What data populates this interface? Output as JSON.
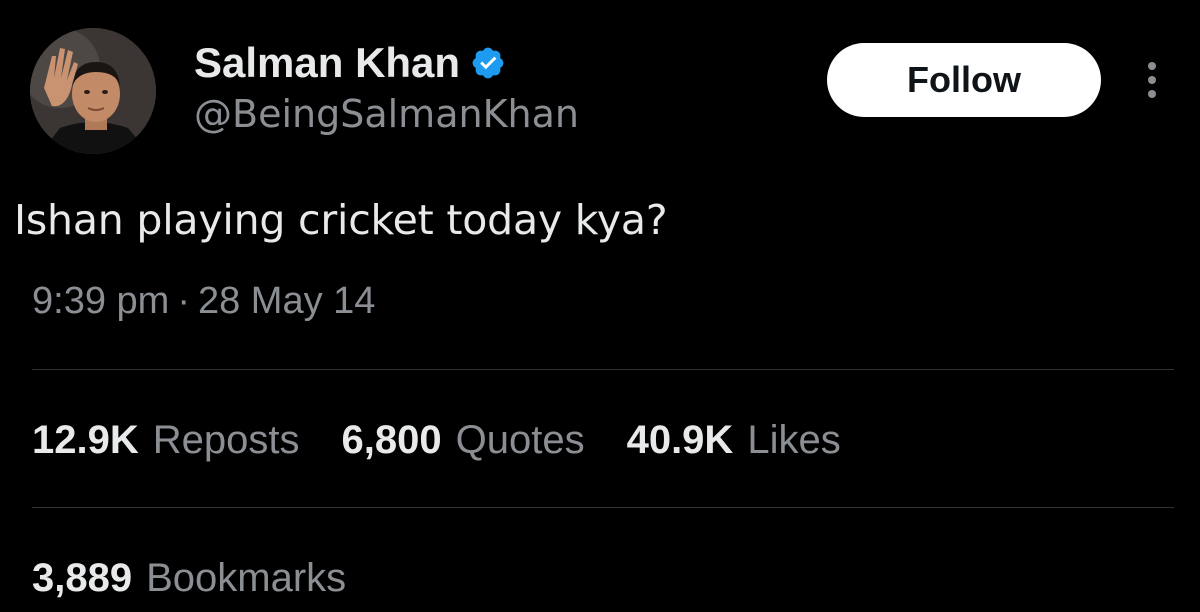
{
  "author": {
    "display_name": "Salman Khan",
    "handle": "@BeingSalmanKhan",
    "verified_color": "#1d9bf0"
  },
  "follow_label": "Follow",
  "tweet": {
    "text": "Ishan playing cricket today kya?",
    "time": "9:39 pm",
    "separator": "·",
    "date": "28 May 14"
  },
  "stats": {
    "reposts_count": "12.9K",
    "reposts_label": "Reposts",
    "quotes_count": "6,800",
    "quotes_label": "Quotes",
    "likes_count": "40.9K",
    "likes_label": "Likes",
    "bookmarks_count": "3,889",
    "bookmarks_label": "Bookmarks"
  },
  "icons": {
    "verified": "verified-badge-icon",
    "more": "more-vertical-icon"
  },
  "colors": {
    "background": "#000000",
    "primary_text": "#e7e9ea",
    "secondary_text": "#8b8f94",
    "divider": "#2f3336",
    "button_bg": "#ffffff"
  }
}
